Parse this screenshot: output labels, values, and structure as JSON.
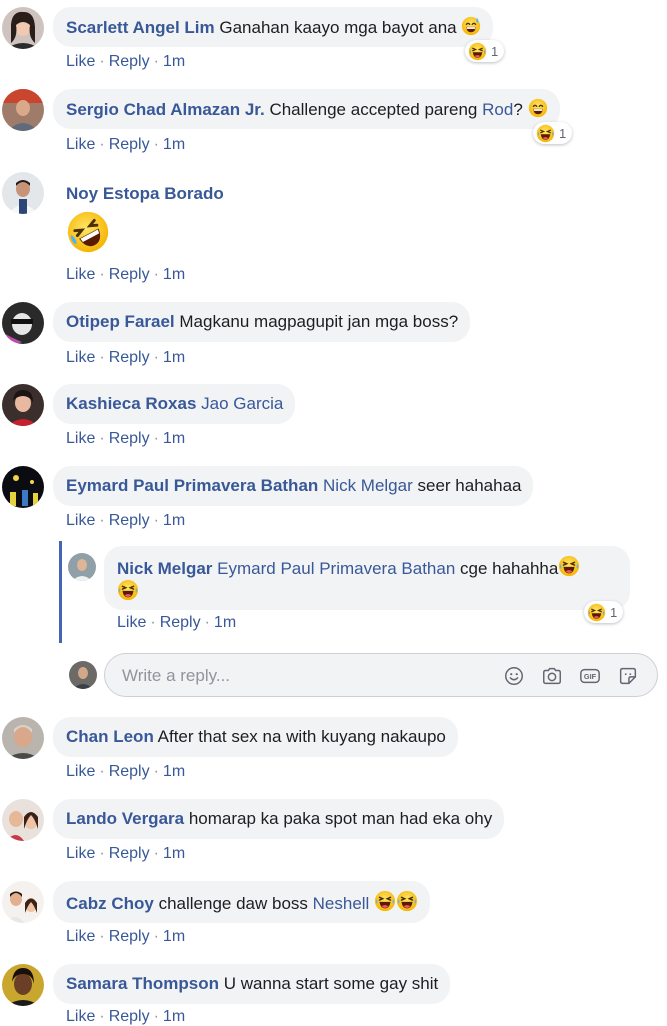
{
  "comments": [
    {
      "author": "Scarlett Angel Lim",
      "text": "Ganahan kaayo mga bayot ana",
      "reaction_count": "1",
      "actions": {
        "like": "Like",
        "reply": "Reply",
        "time": "1m"
      }
    },
    {
      "author": "Sergio Chad Almazan Jr.",
      "text": "Challenge accepted pareng",
      "tag": "Rod",
      "text_after": "?",
      "reaction_count": "1",
      "actions": {
        "like": "Like",
        "reply": "Reply",
        "time": "1m"
      }
    },
    {
      "author": "Noy Estopa Borado",
      "actions": {
        "like": "Like",
        "reply": "Reply",
        "time": "1m"
      }
    },
    {
      "author": "Otipep Farael",
      "text": "Magkanu magpagupit jan mga boss?",
      "actions": {
        "like": "Like",
        "reply": "Reply",
        "time": "1m"
      }
    },
    {
      "author": "Kashieca Roxas",
      "tag": "Jao Garcia",
      "actions": {
        "like": "Like",
        "reply": "Reply",
        "time": "1m"
      }
    },
    {
      "author": "Eymard Paul Primavera Bathan",
      "tag": "Nick Melgar",
      "text": "seer hahahaa",
      "actions": {
        "like": "Like",
        "reply": "Reply",
        "time": "1m"
      }
    },
    {
      "author": "Chan Leon",
      "text": "After that sex na with kuyang nakaupo",
      "actions": {
        "like": "Like",
        "reply": "Reply",
        "time": "1m"
      }
    },
    {
      "author": "Lando Vergara",
      "text": "homarap ka paka spot man had eka ohy",
      "actions": {
        "like": "Like",
        "reply": "Reply",
        "time": "1m"
      }
    },
    {
      "author": "Cabz Choy",
      "text": "challenge daw boss",
      "tag": "Neshell",
      "actions": {
        "like": "Like",
        "reply": "Reply",
        "time": "1m"
      }
    },
    {
      "author": "Samara Thompson",
      "text": "U wanna start some gay shit",
      "actions": {
        "like": "Like",
        "reply": "Reply",
        "time": "1m"
      }
    }
  ],
  "reply": {
    "author": "Nick Melgar",
    "tag": "Eymard Paul Primavera Bathan",
    "text": "cge hahahha",
    "reaction_count": "1",
    "actions": {
      "like": "Like",
      "reply": "Reply",
      "time": "1m"
    }
  },
  "reply_box": {
    "placeholder": "Write a reply..."
  },
  "icons": [
    "emoji-icon",
    "camera-icon",
    "gif-icon",
    "sticker-icon",
    "laughing-emoji",
    "grinning-sweat-emoji",
    "grinning-emoji",
    "rofl-emoji"
  ],
  "colors": {
    "link": "#385898",
    "bubble": "#f2f3f5",
    "thread_line": "#4267b2",
    "meta": "#90949c"
  }
}
